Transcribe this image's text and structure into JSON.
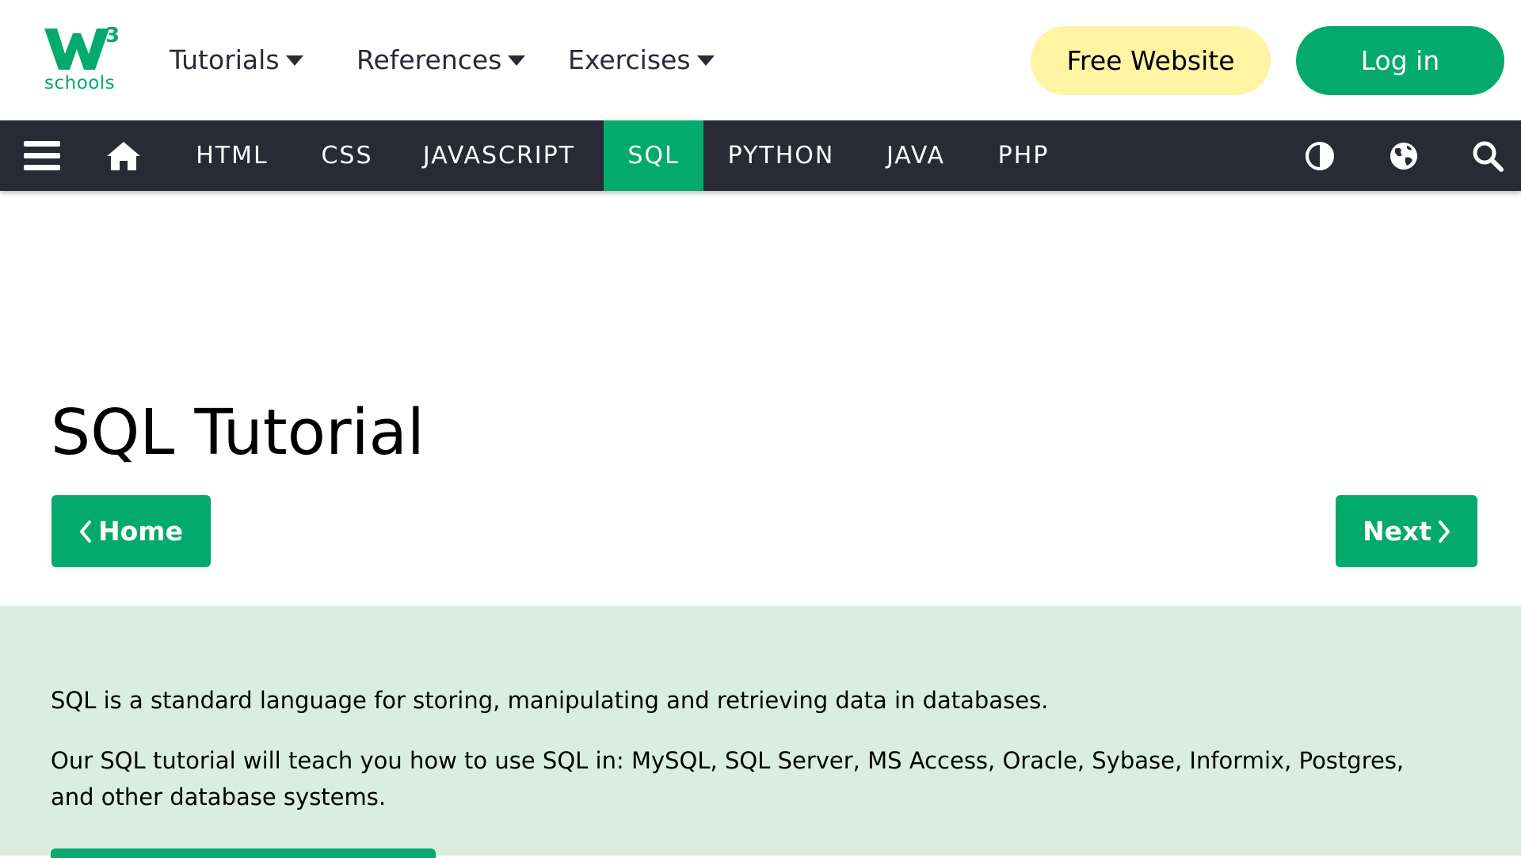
{
  "brand": {
    "number": "3",
    "name": "schools",
    "accent": "#04AA6D"
  },
  "topnav": {
    "tutorials": "Tutorials",
    "references": "References",
    "exercises": "Exercises",
    "free_website": "Free Website",
    "login": "Log in"
  },
  "subnav": {
    "items": [
      "HTML",
      "CSS",
      "JAVASCRIPT",
      "SQL",
      "PYTHON",
      "JAVA",
      "PHP"
    ],
    "active": "SQL",
    "icons": [
      "menu-icon",
      "home-icon",
      "contrast-icon",
      "globe-icon",
      "search-icon"
    ],
    "background": "#282A35"
  },
  "main": {
    "title": "SQL Tutorial",
    "prev_label": "Home",
    "next_label": "Next",
    "intro_bg": "#D9EEE1",
    "intro_p1": "SQL is a standard language for storing, manipulating and retrieving data in databases.",
    "intro_p2": "Our SQL tutorial will teach you how to use SQL in: MySQL, SQL Server, MS Access, Oracle, Sybase, Informix, Postgres, and other database systems."
  }
}
